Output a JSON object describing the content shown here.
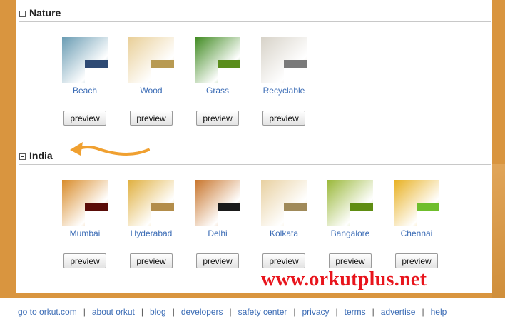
{
  "sections": [
    {
      "title": "Nature",
      "themes": [
        {
          "name": "Beach",
          "preview_label": "preview",
          "swatch_color": "#2e4a74",
          "thumb_color": "#6a9cb3"
        },
        {
          "name": "Wood",
          "preview_label": "preview",
          "swatch_color": "#b89a52",
          "thumb_color": "#e9cf98"
        },
        {
          "name": "Grass",
          "preview_label": "preview",
          "swatch_color": "#5a8d1c",
          "thumb_color": "#3f8a20"
        },
        {
          "name": "Recyclable",
          "preview_label": "preview",
          "swatch_color": "#7a7a7a",
          "thumb_color": "#d7d2c8"
        }
      ]
    },
    {
      "title": "India",
      "themes": [
        {
          "name": "Mumbai",
          "preview_label": "preview",
          "swatch_color": "#5a0c08",
          "thumb_color": "#d98c2a"
        },
        {
          "name": "Hyderabad",
          "preview_label": "preview",
          "swatch_color": "#b38d4a",
          "thumb_color": "#e0b040"
        },
        {
          "name": "Delhi",
          "preview_label": "preview",
          "swatch_color": "#1a1a1a",
          "thumb_color": "#c8742a"
        },
        {
          "name": "Kolkata",
          "preview_label": "preview",
          "swatch_color": "#a08a5a",
          "thumb_color": "#e8d0a0"
        },
        {
          "name": "Bangalore",
          "preview_label": "preview",
          "swatch_color": "#5f8d12",
          "thumb_color": "#9ab83a"
        },
        {
          "name": "Chennai",
          "preview_label": "preview",
          "swatch_color": "#6fbe2c",
          "thumb_color": "#e8b020"
        }
      ]
    }
  ],
  "watermark": "www.orkutplus.net",
  "footer": {
    "links": [
      "go to orkut.com",
      "about orkut",
      "blog",
      "developers",
      "safety center",
      "privacy",
      "terms",
      "advertise",
      "help"
    ],
    "separator": "|"
  },
  "colors": {
    "frame": "#d9953f",
    "link": "#3a6bb5",
    "arrow": "#f0a030",
    "watermark": "#e8141c"
  }
}
